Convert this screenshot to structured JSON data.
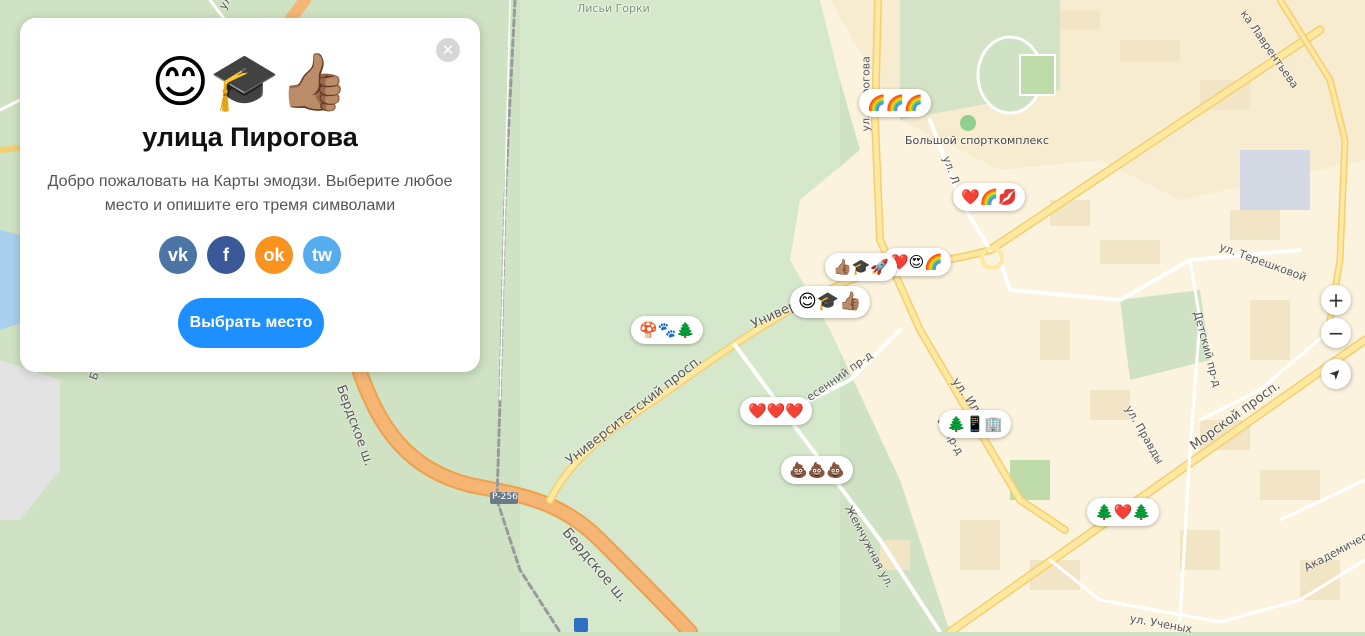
{
  "card": {
    "emojis": "😊🎓👍🏽",
    "title": "улица Пирогова",
    "description": "Добро пожаловать на Карты эмодзи. Выберите любое место и опишите его тремя символами",
    "socials": [
      {
        "name": "vk",
        "glyph": "vk",
        "color": "#4c75a3"
      },
      {
        "name": "facebook",
        "glyph": "f",
        "color": "#3b5998"
      },
      {
        "name": "odnoklassniki",
        "glyph": "ok",
        "color": "#f7931e"
      },
      {
        "name": "twitter",
        "glyph": "tw",
        "color": "#55acee"
      }
    ],
    "choose_button": "Выбрать место",
    "close_glyph": "✕"
  },
  "map": {
    "labels": {
      "lisi_gorki": "Лисьи Горки",
      "ul_pirogova": "ул. Пирогова",
      "sport_complex": "Большой спорткомплекс",
      "ul_lavrentieva": "ка Лаврентьева",
      "ul_tereshkovoi": "ул. Терешковой",
      "detsky_pr": "Детский пр-д",
      "ul_pravdy": "ул. Правды",
      "morskoy_prosp": "Морской просп.",
      "univer_prosp": "Университетский просп.",
      "univer_short": "Универ",
      "berdskoe_sh": "Бердское ш.",
      "berdskoe_sh_2": "Бердское ш.",
      "r256": "Р-256",
      "osenniy_pr": "есенний пр-д",
      "ul_ilicha": "ул. Ильи",
      "shlyuzovoy_pr": "Ш пр-д",
      "zhemchuzhnaya": "Жемчужная ул.",
      "ul_uchenykh": "ул. Ученых",
      "akademicheskaya": "Академическ",
      "ul_zolotodolinskaya": "ул. Л",
      "bers": "Берс",
      "ul_left": "ул."
    },
    "pins": [
      {
        "name": "pin-rainbows",
        "emoji": "🌈🌈🌈"
      },
      {
        "name": "pin-heart-rainbow-kiss",
        "emoji": "❤️🌈💋"
      },
      {
        "name": "pin-heart-love-rainbow",
        "emoji": "❤️😍🌈"
      },
      {
        "name": "pin-thumb-grad-rocket",
        "emoji": "👍🏽🎓🚀"
      },
      {
        "name": "pin-selected",
        "emoji": "😊🎓👍🏽"
      },
      {
        "name": "pin-mushroom-paws-tree",
        "emoji": "🍄🐾🌲"
      },
      {
        "name": "pin-three-hearts",
        "emoji": "❤️❤️❤️"
      },
      {
        "name": "pin-three-poops",
        "emoji": "💩💩💩"
      },
      {
        "name": "pin-tree-phone-office",
        "emoji": "🌲📱🏢"
      },
      {
        "name": "pin-tree-heart-tree",
        "emoji": "🌲❤️🌲"
      }
    ],
    "controls": {
      "zoom_in": "+",
      "zoom_out": "−",
      "locate": "➤"
    }
  }
}
